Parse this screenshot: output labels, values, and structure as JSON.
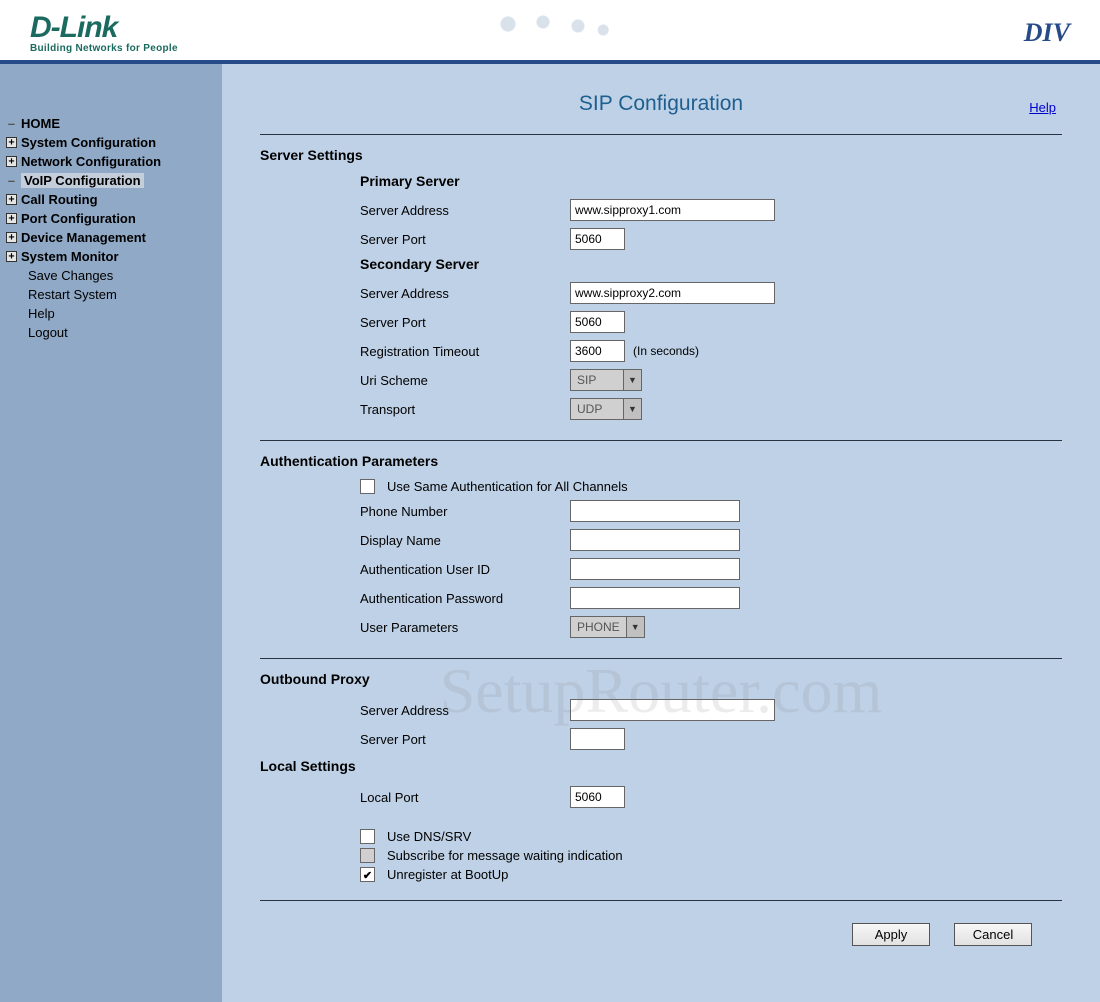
{
  "header": {
    "logo_main": "D-Link",
    "logo_tag": "Building Networks for People",
    "brand_right": "DIV"
  },
  "sidebar": {
    "items": [
      {
        "label": "HOME",
        "expand": null,
        "weight": "bold"
      },
      {
        "label": "System Configuration",
        "expand": "plus",
        "weight": "bold"
      },
      {
        "label": "Network Configuration",
        "expand": "plus",
        "weight": "bold"
      },
      {
        "label": "VoIP Configuration",
        "expand": null,
        "weight": "bold",
        "selected": true
      },
      {
        "label": "Call Routing",
        "expand": "plus",
        "weight": "bold"
      },
      {
        "label": "Port Configuration",
        "expand": "plus",
        "weight": "bold"
      },
      {
        "label": "Device Management",
        "expand": "plus",
        "weight": "bold"
      },
      {
        "label": "System Monitor",
        "expand": "plus",
        "weight": "bold"
      },
      {
        "label": "Save Changes",
        "expand": null,
        "weight": "plain"
      },
      {
        "label": "Restart System",
        "expand": null,
        "weight": "plain"
      },
      {
        "label": "Help",
        "expand": null,
        "weight": "plain"
      },
      {
        "label": "Logout",
        "expand": null,
        "weight": "plain"
      }
    ]
  },
  "page": {
    "title": "SIP Configuration",
    "help": "Help"
  },
  "server_settings": {
    "heading": "Server Settings",
    "primary_heading": "Primary Server",
    "primary_addr_label": "Server Address",
    "primary_addr_value": "www.sipproxy1.com",
    "primary_port_label": "Server Port",
    "primary_port_value": "5060",
    "secondary_heading": "Secondary Server",
    "secondary_addr_label": "Server Address",
    "secondary_addr_value": "www.sipproxy2.com",
    "secondary_port_label": "Server Port",
    "secondary_port_value": "5060",
    "reg_timeout_label": "Registration Timeout",
    "reg_timeout_value": "3600",
    "reg_timeout_note": "(In seconds)",
    "uri_scheme_label": "Uri Scheme",
    "uri_scheme_value": "SIP",
    "transport_label": "Transport",
    "transport_value": "UDP"
  },
  "auth": {
    "heading": "Authentication Parameters",
    "same_auth_label": "Use Same Authentication for All Channels",
    "phone_label": "Phone Number",
    "phone_value": "",
    "display_label": "Display Name",
    "display_value": "",
    "userid_label": "Authentication User ID",
    "userid_value": "",
    "password_label": "Authentication Password",
    "password_value": "",
    "userparam_label": "User Parameters",
    "userparam_value": "PHONE"
  },
  "outbound": {
    "heading": "Outbound Proxy",
    "addr_label": "Server Address",
    "addr_value": "",
    "port_label": "Server Port",
    "port_value": ""
  },
  "local": {
    "heading": "Local Settings",
    "port_label": "Local Port",
    "port_value": "5060",
    "dns_label": "Use DNS/SRV",
    "mwi_label": "Subscribe for message waiting indication",
    "unreg_label": "Unregister at BootUp"
  },
  "buttons": {
    "apply": "Apply",
    "cancel": "Cancel"
  },
  "watermark": "SetupRouter.com"
}
